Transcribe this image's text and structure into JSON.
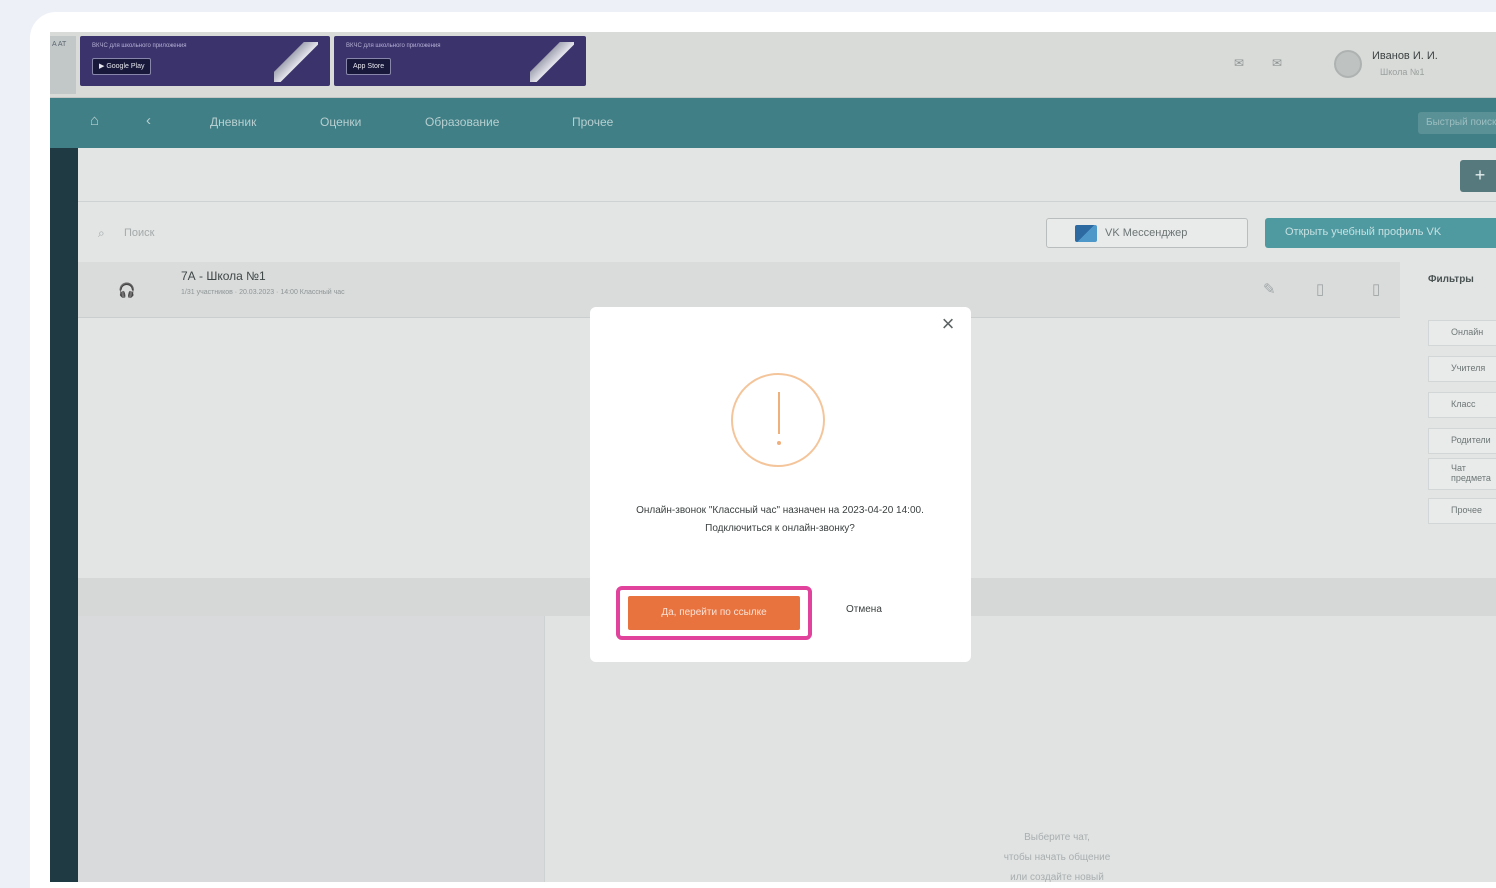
{
  "header": {
    "logo_text": "A AT",
    "banners": [
      {
        "title": "ВКЧС для школьного приложения",
        "store": "▶ Google Play"
      },
      {
        "title": "ВКЧС для школьного приложения",
        "store": " App Store"
      }
    ],
    "user": {
      "name": "Иванов И. И.",
      "subtitle": "Школа №1"
    }
  },
  "nav": {
    "items": [
      "Дневник",
      "Оценки",
      "Образование",
      "Прочее"
    ],
    "search_placeholder": "Быстрый поиск"
  },
  "toolbar": {
    "plus_label": "+"
  },
  "search": {
    "placeholder": "Поиск"
  },
  "buttons": {
    "vk": "VK Мессенджер",
    "open_schedule": "Открыть учебный профиль VK"
  },
  "chat": {
    "title": "7А - Школа №1",
    "meta": "1/31 участников  ·  20.03.2023  ·  14:00 Классный час"
  },
  "filters": {
    "title": "Фильтры",
    "items": [
      "Онлайн",
      "Учителя",
      "Класс",
      "Родители",
      "Чат предмета",
      "Прочее"
    ]
  },
  "empty_state": {
    "lines": [
      "Выберите чат,",
      "чтобы начать общение",
      "или создайте новый"
    ]
  },
  "modal": {
    "message": "Онлайн-звонок \"Классный час\" назначен на 2023-04-20 14:00. Подключиться к онлайн-звонку?",
    "confirm": "Да, перейти по ссылке",
    "cancel": "Отмена"
  },
  "colors": {
    "nav_bg": "#3f7f85",
    "accent_button": "#e8733e",
    "highlight": "#e1429c",
    "warning_ring": "#f4c59b"
  }
}
